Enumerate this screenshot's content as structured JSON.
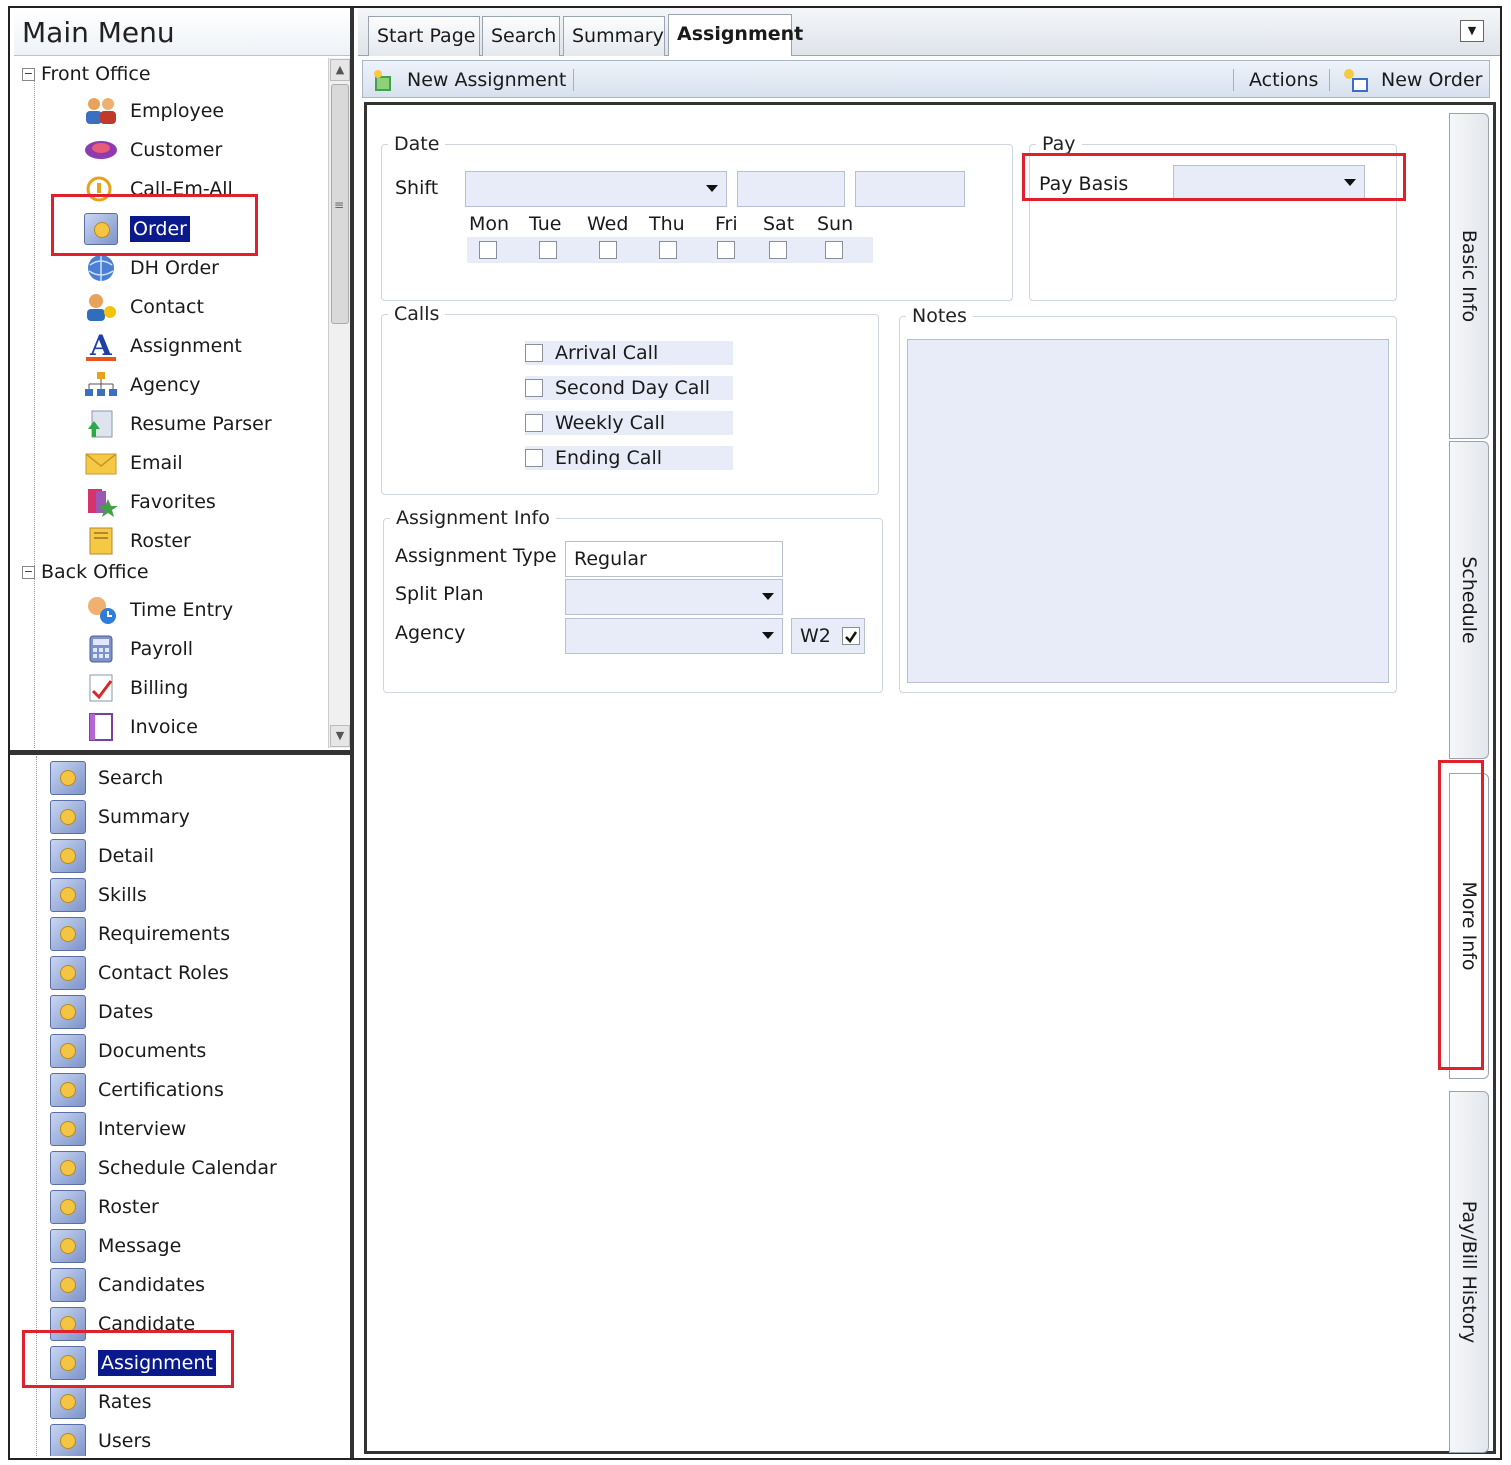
{
  "main_menu": {
    "title": "Main Menu",
    "groups": [
      {
        "label": "Front Office",
        "expander": "−",
        "items": [
          {
            "label": "Employee",
            "icon": "employees-icon"
          },
          {
            "label": "Customer",
            "icon": "customer-icon"
          },
          {
            "label": "Call-Em-All",
            "icon": "call-em-all-icon"
          },
          {
            "label": "Order",
            "icon": "order-icon",
            "selected": true
          },
          {
            "label": "DH Order",
            "icon": "globe-icon"
          },
          {
            "label": "Contact",
            "icon": "contact-icon"
          },
          {
            "label": "Assignment",
            "icon": "assignment-icon"
          },
          {
            "label": "Agency",
            "icon": "org-chart-icon"
          },
          {
            "label": "Resume Parser",
            "icon": "resume-parser-icon"
          },
          {
            "label": "Email",
            "icon": "email-icon"
          },
          {
            "label": "Favorites",
            "icon": "favorites-icon"
          },
          {
            "label": "Roster",
            "icon": "roster-icon"
          }
        ]
      },
      {
        "label": "Back Office",
        "expander": "−",
        "items": [
          {
            "label": "Time Entry",
            "icon": "time-entry-icon"
          },
          {
            "label": "Payroll",
            "icon": "payroll-icon"
          },
          {
            "label": "Billing",
            "icon": "billing-icon"
          },
          {
            "label": "Invoice",
            "icon": "invoice-icon"
          }
        ]
      }
    ]
  },
  "order_nav": {
    "items": [
      {
        "label": "Search"
      },
      {
        "label": "Summary"
      },
      {
        "label": "Detail"
      },
      {
        "label": "Skills"
      },
      {
        "label": "Requirements"
      },
      {
        "label": "Contact Roles"
      },
      {
        "label": "Dates"
      },
      {
        "label": "Documents"
      },
      {
        "label": "Certifications"
      },
      {
        "label": "Interview"
      },
      {
        "label": "Schedule Calendar"
      },
      {
        "label": "Roster"
      },
      {
        "label": "Message"
      },
      {
        "label": "Candidates"
      },
      {
        "label": "Candidate"
      },
      {
        "label": "Assignment",
        "selected": true
      },
      {
        "label": "Rates"
      },
      {
        "label": "Users"
      }
    ]
  },
  "tabs": [
    {
      "label": "Start Page"
    },
    {
      "label": "Search"
    },
    {
      "label": "Summary"
    },
    {
      "label": "Assignment",
      "active": true
    }
  ],
  "toolbar": {
    "new_assignment": "New Assignment",
    "actions": "Actions",
    "new_order": "New Order"
  },
  "form": {
    "date": {
      "legend": "Date",
      "shift_label": "Shift",
      "shift_value": "",
      "start_time": "",
      "end_time": "",
      "days": [
        {
          "label": "Mon",
          "checked": false
        },
        {
          "label": "Tue",
          "checked": false
        },
        {
          "label": "Wed",
          "checked": false
        },
        {
          "label": "Thu",
          "checked": false
        },
        {
          "label": "Fri",
          "checked": false
        },
        {
          "label": "Sat",
          "checked": false
        },
        {
          "label": "Sun",
          "checked": false
        }
      ]
    },
    "pay": {
      "legend": "Pay",
      "pay_basis_label": "Pay Basis",
      "pay_basis_value": ""
    },
    "calls": {
      "legend": "Calls",
      "items": [
        {
          "label": "Arrival Call",
          "checked": false
        },
        {
          "label": "Second Day Call",
          "checked": false
        },
        {
          "label": "Weekly Call",
          "checked": false
        },
        {
          "label": "Ending Call",
          "checked": false
        }
      ]
    },
    "notes": {
      "legend": "Notes",
      "value": ""
    },
    "assignment_info": {
      "legend": "Assignment Info",
      "type_label": "Assignment Type",
      "type_value": "Regular",
      "split_plan_label": "Split Plan",
      "split_plan_value": "",
      "agency_label": "Agency",
      "agency_value": "",
      "w2_label": "W2",
      "w2_checked": true
    }
  },
  "side_tabs": [
    {
      "label": "Basic Info"
    },
    {
      "label": "Schedule"
    },
    {
      "label": "More Info",
      "active": true
    },
    {
      "label": "Pay/Bill History"
    }
  ],
  "colors": {
    "selection": "#0a1a8c",
    "highlight": "#e0202a",
    "input_fill": "#e8ebf8"
  }
}
